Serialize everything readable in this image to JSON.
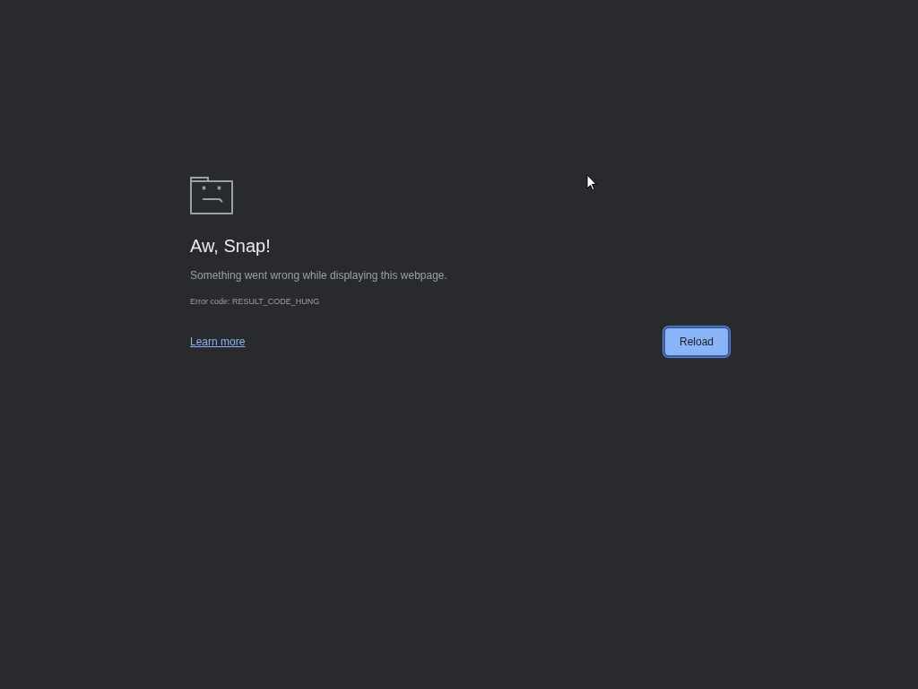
{
  "title": "Aw, Snap!",
  "message": "Something went wrong while displaying this webpage.",
  "error_code": "Error code: RESULT_CODE_HUNG",
  "link": "Learn more",
  "button": {
    "label": "Reload",
    "focused": true
  }
}
